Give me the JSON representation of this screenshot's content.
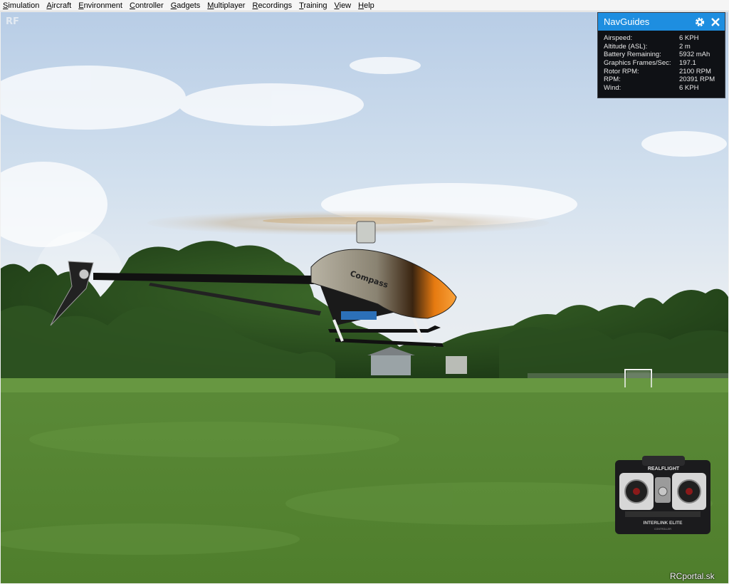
{
  "menubar": {
    "items": [
      {
        "label": "Simulation",
        "accel": "S",
        "rest": "imulation"
      },
      {
        "label": "Aircraft",
        "accel": "A",
        "rest": "ircraft"
      },
      {
        "label": "Environment",
        "accel": "E",
        "rest": "nvironment"
      },
      {
        "label": "Controller",
        "accel": "C",
        "rest": "ontroller"
      },
      {
        "label": "Gadgets",
        "accel": "G",
        "rest": "adgets"
      },
      {
        "label": "Multiplayer",
        "accel": "M",
        "rest": "ultiplayer"
      },
      {
        "label": "Recordings",
        "accel": "R",
        "rest": "ecordings"
      },
      {
        "label": "Training",
        "accel": "T",
        "rest": "raining"
      },
      {
        "label": "View",
        "accel": "V",
        "rest": "iew"
      },
      {
        "label": "Help",
        "accel": "H",
        "rest": "elp"
      }
    ]
  },
  "navguides": {
    "title": "NavGuides",
    "settings_icon": "gear-icon",
    "close_icon": "close-icon",
    "rows": [
      {
        "label": "Airspeed:",
        "value": "6 KPH"
      },
      {
        "label": "Altitude (ASL):",
        "value": "2 m"
      },
      {
        "label": "Battery Remaining:",
        "value": "5932 mAh"
      },
      {
        "label": "Graphics Frames/Sec:",
        "value": "197.1"
      },
      {
        "label": "Rotor RPM:",
        "value": "2100 RPM"
      },
      {
        "label": "RPM:",
        "value": "20391 RPM"
      },
      {
        "label": "Wind:",
        "value": "6 KPH"
      }
    ],
    "accent_color": "#1e8ee0"
  },
  "transmitter": {
    "brand": "REALFLIGHT",
    "model": "INTERLINK ELITE",
    "model_sub": "CONTROLLER"
  },
  "helicopter": {
    "canopy_text": "Compass"
  },
  "corner_logo": "RF",
  "watermark": "RCportal.sk"
}
